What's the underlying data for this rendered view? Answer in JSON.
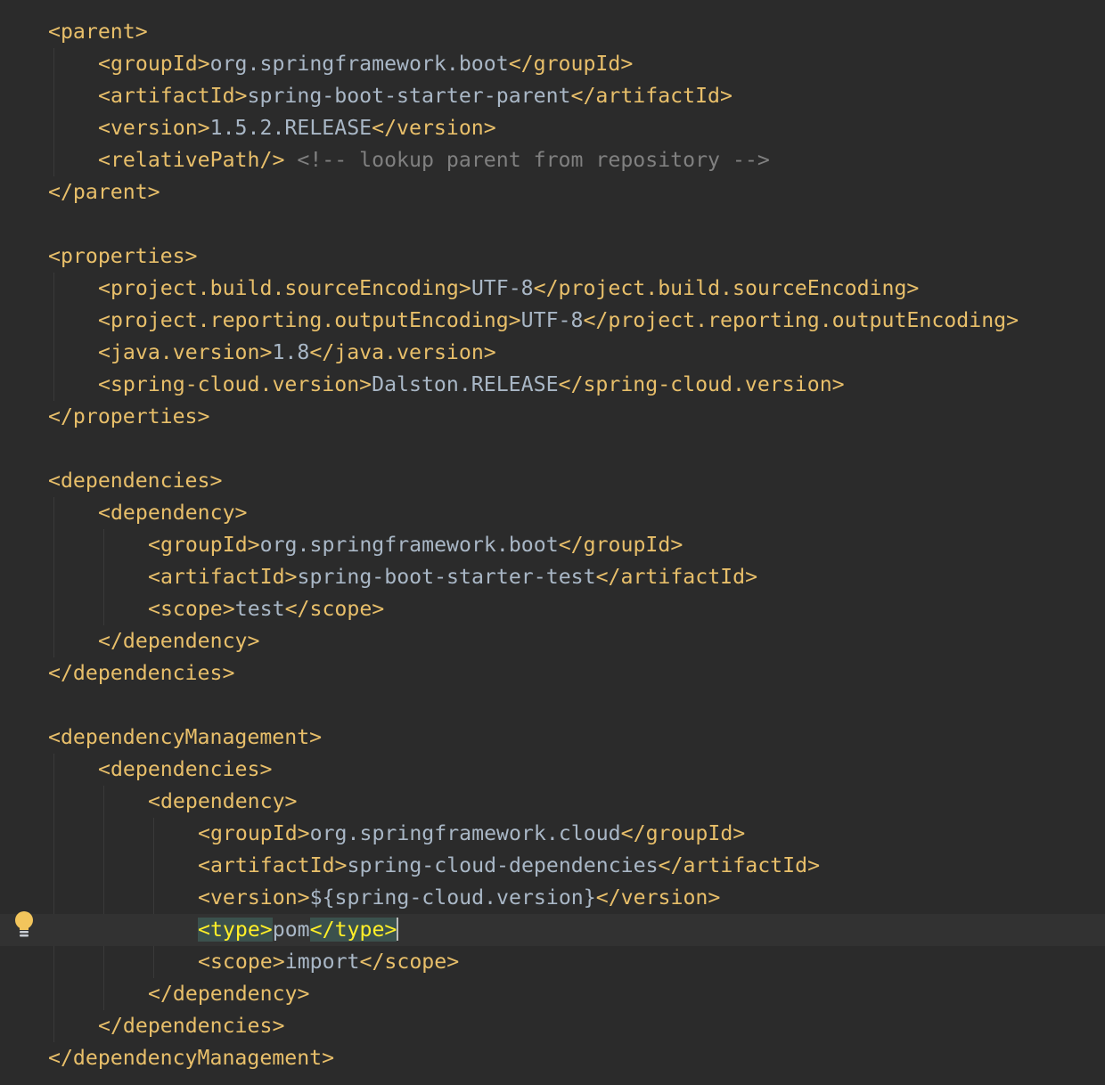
{
  "editor": {
    "current_line_index": 28,
    "colors": {
      "background": "#2b2b2b",
      "tag": "#e8bf6a",
      "text": "#a9b7c6",
      "comment": "#808080",
      "current_line": "#323232",
      "brace_match_bg": "#3b514d",
      "brace_match_fg": "#ffef28"
    },
    "gutter_icon": "lightbulb-icon",
    "lines": [
      {
        "indent": 0,
        "tokens": [
          {
            "t": "tag",
            "v": "<parent>"
          }
        ]
      },
      {
        "indent": 1,
        "tokens": [
          {
            "t": "tag",
            "v": "<groupId>"
          },
          {
            "t": "text",
            "v": "org.springframework.boot"
          },
          {
            "t": "tag",
            "v": "</groupId>"
          }
        ]
      },
      {
        "indent": 1,
        "tokens": [
          {
            "t": "tag",
            "v": "<artifactId>"
          },
          {
            "t": "text",
            "v": "spring-boot-starter-parent"
          },
          {
            "t": "tag",
            "v": "</artifactId>"
          }
        ]
      },
      {
        "indent": 1,
        "tokens": [
          {
            "t": "tag",
            "v": "<version>"
          },
          {
            "t": "text",
            "v": "1.5.2.RELEASE"
          },
          {
            "t": "tag",
            "v": "</version>"
          }
        ]
      },
      {
        "indent": 1,
        "tokens": [
          {
            "t": "tag",
            "v": "<relativePath/>"
          },
          {
            "t": "text",
            "v": " "
          },
          {
            "t": "comment",
            "v": "<!-- lookup parent from repository -->"
          }
        ]
      },
      {
        "indent": 0,
        "tokens": [
          {
            "t": "tag",
            "v": "</parent>"
          }
        ]
      },
      {
        "indent": 0,
        "tokens": []
      },
      {
        "indent": 0,
        "tokens": [
          {
            "t": "tag",
            "v": "<properties>"
          }
        ]
      },
      {
        "indent": 1,
        "tokens": [
          {
            "t": "tag",
            "v": "<project.build.sourceEncoding>"
          },
          {
            "t": "text",
            "v": "UTF-8"
          },
          {
            "t": "tag",
            "v": "</project.build.sourceEncoding>"
          }
        ]
      },
      {
        "indent": 1,
        "tokens": [
          {
            "t": "tag",
            "v": "<project.reporting.outputEncoding>"
          },
          {
            "t": "text",
            "v": "UTF-8"
          },
          {
            "t": "tag",
            "v": "</project.reporting.outputEncoding>"
          }
        ]
      },
      {
        "indent": 1,
        "tokens": [
          {
            "t": "tag",
            "v": "<java.version>"
          },
          {
            "t": "text",
            "v": "1.8"
          },
          {
            "t": "tag",
            "v": "</java.version>"
          }
        ]
      },
      {
        "indent": 1,
        "tokens": [
          {
            "t": "tag",
            "v": "<spring-cloud.version>"
          },
          {
            "t": "text",
            "v": "Dalston.RELEASE"
          },
          {
            "t": "tag",
            "v": "</spring-cloud.version>"
          }
        ]
      },
      {
        "indent": 0,
        "tokens": [
          {
            "t": "tag",
            "v": "</properties>"
          }
        ]
      },
      {
        "indent": 0,
        "tokens": []
      },
      {
        "indent": 0,
        "tokens": [
          {
            "t": "tag",
            "v": "<dependencies>"
          }
        ]
      },
      {
        "indent": 1,
        "tokens": [
          {
            "t": "tag",
            "v": "<dependency>"
          }
        ]
      },
      {
        "indent": 2,
        "tokens": [
          {
            "t": "tag",
            "v": "<groupId>"
          },
          {
            "t": "text",
            "v": "org.springframework.boot"
          },
          {
            "t": "tag",
            "v": "</groupId>"
          }
        ]
      },
      {
        "indent": 2,
        "tokens": [
          {
            "t": "tag",
            "v": "<artifactId>"
          },
          {
            "t": "text",
            "v": "spring-boot-starter-test"
          },
          {
            "t": "tag",
            "v": "</artifactId>"
          }
        ]
      },
      {
        "indent": 2,
        "tokens": [
          {
            "t": "tag",
            "v": "<scope>"
          },
          {
            "t": "text",
            "v": "test"
          },
          {
            "t": "tag",
            "v": "</scope>"
          }
        ]
      },
      {
        "indent": 1,
        "tokens": [
          {
            "t": "tag",
            "v": "</dependency>"
          }
        ]
      },
      {
        "indent": 0,
        "tokens": [
          {
            "t": "tag",
            "v": "</dependencies>"
          }
        ]
      },
      {
        "indent": 0,
        "tokens": []
      },
      {
        "indent": 0,
        "tokens": [
          {
            "t": "tag",
            "v": "<dependencyManagement>"
          }
        ]
      },
      {
        "indent": 1,
        "tokens": [
          {
            "t": "tag",
            "v": "<dependencies>"
          }
        ]
      },
      {
        "indent": 2,
        "tokens": [
          {
            "t": "tag",
            "v": "<dependency>"
          }
        ]
      },
      {
        "indent": 3,
        "tokens": [
          {
            "t": "tag",
            "v": "<groupId>"
          },
          {
            "t": "text",
            "v": "org.springframework.cloud"
          },
          {
            "t": "tag",
            "v": "</groupId>"
          }
        ]
      },
      {
        "indent": 3,
        "tokens": [
          {
            "t": "tag",
            "v": "<artifactId>"
          },
          {
            "t": "text",
            "v": "spring-cloud-dependencies"
          },
          {
            "t": "tag",
            "v": "</artifactId>"
          }
        ]
      },
      {
        "indent": 3,
        "tokens": [
          {
            "t": "tag",
            "v": "<version>"
          },
          {
            "t": "text",
            "v": "${spring-cloud.version}"
          },
          {
            "t": "tag",
            "v": "</version>"
          }
        ]
      },
      {
        "indent": 3,
        "tokens": [
          {
            "t": "tag",
            "v": "<type>",
            "match": true
          },
          {
            "t": "text",
            "v": "pom"
          },
          {
            "t": "tag",
            "v": "</type>",
            "match": true
          }
        ],
        "caret": true
      },
      {
        "indent": 3,
        "tokens": [
          {
            "t": "tag",
            "v": "<scope>"
          },
          {
            "t": "text",
            "v": "import"
          },
          {
            "t": "tag",
            "v": "</scope>"
          }
        ]
      },
      {
        "indent": 2,
        "tokens": [
          {
            "t": "tag",
            "v": "</dependency>"
          }
        ]
      },
      {
        "indent": 1,
        "tokens": [
          {
            "t": "tag",
            "v": "</dependencies>"
          }
        ]
      },
      {
        "indent": 0,
        "tokens": [
          {
            "t": "tag",
            "v": "</dependencyManagement>"
          }
        ]
      }
    ]
  }
}
